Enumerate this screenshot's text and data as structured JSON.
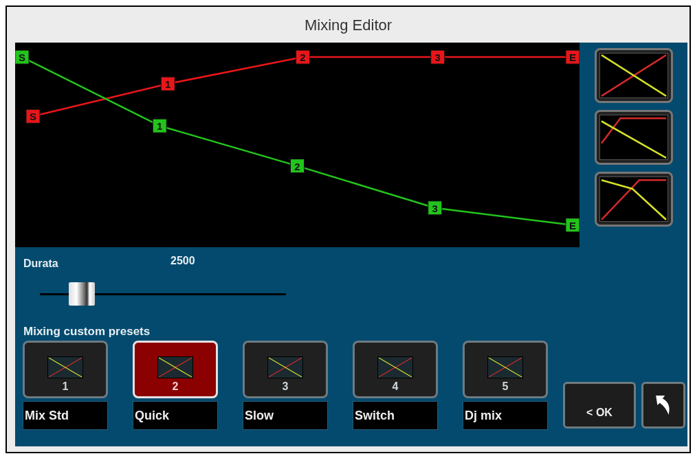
{
  "window": {
    "title": "Mixing Editor"
  },
  "envelope": {
    "curves": [
      {
        "kind": "fade_in",
        "color": "#e8161a",
        "points": [
          "S",
          "1",
          "2",
          "3",
          "E"
        ]
      },
      {
        "kind": "fade_out",
        "color": "#22c41c",
        "points": [
          "S",
          "1",
          "2",
          "3",
          "E"
        ]
      }
    ]
  },
  "curve_shapes": [
    {
      "kind": "linear"
    },
    {
      "kind": "quick"
    },
    {
      "kind": "delayed"
    }
  ],
  "duration": {
    "label": "Durata",
    "value": "2500",
    "level": 0.17
  },
  "presets_title": "Mixing custom presets",
  "presets": [
    {
      "number": "1",
      "name": "Mix Std",
      "selected": false
    },
    {
      "number": "2",
      "name": "Quick",
      "selected": true
    },
    {
      "number": "3",
      "name": "Slow",
      "selected": false
    },
    {
      "number": "4",
      "name": "Switch",
      "selected": false
    },
    {
      "number": "5",
      "name": "Dj mix",
      "selected": false
    }
  ],
  "ok_button": "< OK"
}
